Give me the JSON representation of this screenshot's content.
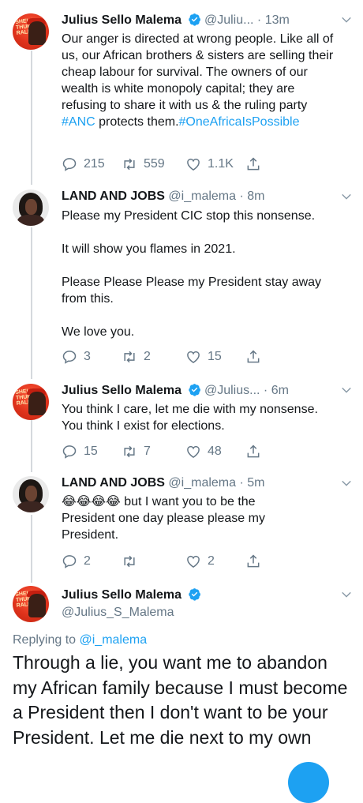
{
  "tweets": [
    {
      "name": "Julius Sello Malema",
      "handle": "@Juliu...",
      "time": "13m",
      "text_parts": [
        "Our anger is directed at wrong people. Like all of us, our African brothers & sisters are selling their cheap labour for survival. The owners of our wealth is white monopoly capital; they are refusing to share it with us & the ruling party ",
        "#ANC",
        " protects them.",
        "#OneAfricaIsPossible"
      ],
      "avatar_text": "SHELA THUPA RALLY",
      "replies": "215",
      "retweets": "559",
      "likes": "1.1K"
    },
    {
      "name": "LAND AND JOBS",
      "handle": "@i_malema",
      "time": "8m",
      "text": "Please my President CIC stop this nonsense.\n\nIt will show you flames in 2021.\n\nPlease Please Please my President stay away from this.\n\nWe love you.",
      "replies": "3",
      "retweets": "2",
      "likes": "15"
    },
    {
      "name": "Julius Sello Malema",
      "handle": "@Julius...",
      "time": "6m",
      "text": "You think I care, let me die with my nonsense. You think I exist for elections.",
      "avatar_text": "SHELA THUPA RALLY",
      "replies": "15",
      "retweets": "7",
      "likes": "48"
    },
    {
      "name": "LAND AND JOBS",
      "handle": "@i_malema",
      "time": "5m",
      "emojis": "😂😂😂😂",
      "text": " but I want you to be the President one day please please my President.",
      "replies": "2",
      "retweets": "",
      "likes": "2"
    }
  ],
  "focused": {
    "name": "Julius Sello Malema",
    "handle": "@Julius_S_Malema",
    "avatar_text": "SHELA THUPA RALLY",
    "replying_prefix": "Replying to ",
    "replying_to": "@i_malema",
    "text": "Through a lie, you want me to abandon my African family because I must become a President then I don't want to be your President. Let me die next to my own"
  },
  "dot": "·",
  "colors": {
    "accent": "#1da1f2",
    "muted": "#657786",
    "verified": "#1da1f2",
    "avatar_red": "#e0331c"
  }
}
